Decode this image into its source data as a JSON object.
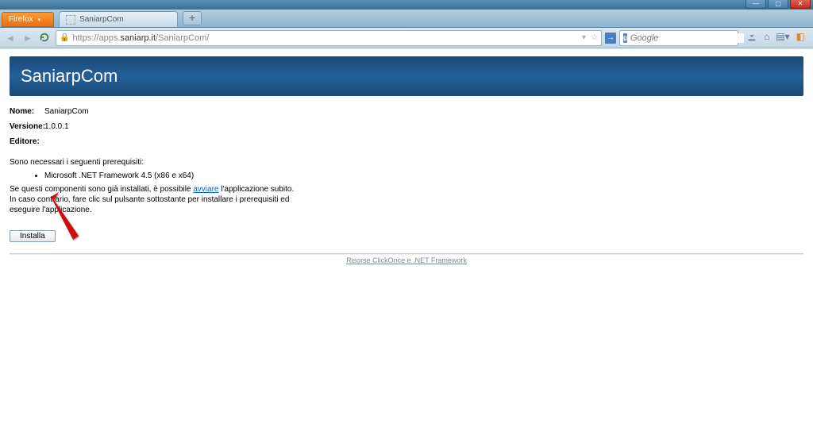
{
  "window": {
    "min": "—",
    "max": "▢",
    "close": "✕"
  },
  "browser": {
    "app_name": "Firefox",
    "tab_title": "SaniarpCom",
    "new_tab": "+",
    "url_prefix": "https://apps.",
    "url_domain": "saniarp.it",
    "url_path": "/SaniarpCom/",
    "search_engine_letter": "g",
    "search_placeholder": "Google",
    "star": "☆",
    "refresh_dd": "▾",
    "go_arrow": "→"
  },
  "page": {
    "title": "SaniarpCom",
    "name_label": "Nome:",
    "name_value": "SaniarpCom",
    "version_label": "Versione:",
    "version_value": "1.0.0.1",
    "publisher_label": "Editore:",
    "publisher_value": "",
    "prereq_intro": "Sono necessari i seguenti prerequisiti:",
    "prereq_item": "Microsoft .NET Framework 4.5 (x86 e x64)",
    "launch_text_1": "Se questi componenti sono già installati, è possibile ",
    "launch_link": "avviare",
    "launch_text_2": " l'applicazione subito. In caso contrario, fare clic sul pulsante sottostante per installare i prerequisiti ed eseguire l'applicazione.",
    "install_btn": "Installa",
    "footer": "Risorse ClickOnce e .NET Framework"
  }
}
